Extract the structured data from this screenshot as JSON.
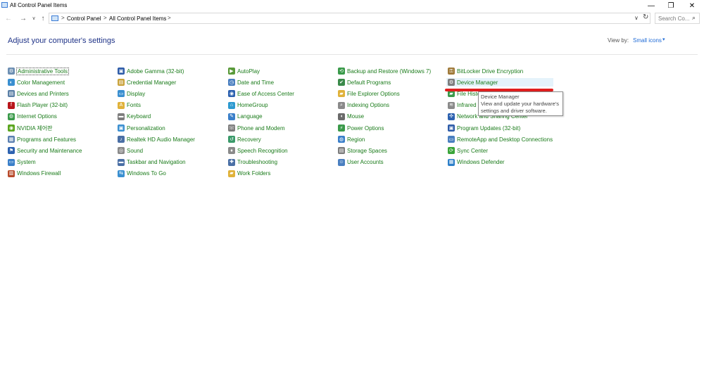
{
  "window": {
    "title": "All Control Panel Items",
    "minimize_glyph": "—",
    "maximize_glyph": "❐",
    "close_glyph": "✕"
  },
  "nav": {
    "back_glyph": "←",
    "forward_glyph": "→",
    "recent_glyph": "∨",
    "up_glyph": "↑",
    "breadcrumb": [
      "Control Panel",
      "All Control Panel Items"
    ],
    "crumb_separator": ">",
    "dropdown_glyph": "∨",
    "refresh_glyph": "↻",
    "search_placeholder": "Search Co...",
    "search_glyph": "⌕"
  },
  "header": {
    "title": "Adjust your computer's settings",
    "view_by_label": "View by:",
    "view_by_value": "Small icons",
    "view_by_caret": "▾"
  },
  "columns": [
    [
      {
        "label": "Administrative Tools",
        "icon": "administrative-tools-icon",
        "color": "#6d8fb3",
        "glyph": "⚙"
      },
      {
        "label": "Color Management",
        "icon": "color-management-icon",
        "color": "#3a8fd0",
        "glyph": "◐"
      },
      {
        "label": "Devices and Printers",
        "icon": "devices-printers-icon",
        "color": "#5b7fa6",
        "glyph": "▤"
      },
      {
        "label": "Flash Player (32-bit)",
        "icon": "flash-player-icon",
        "color": "#b8161b",
        "glyph": "f"
      },
      {
        "label": "Internet Options",
        "icon": "internet-options-icon",
        "color": "#3a9a4a",
        "glyph": "◍"
      },
      {
        "label": "NVIDIA 제어판",
        "icon": "nvidia-icon",
        "color": "#5aa51e",
        "glyph": "◉"
      },
      {
        "label": "Programs and Features",
        "icon": "programs-features-icon",
        "color": "#5a7fb0",
        "glyph": "▦"
      },
      {
        "label": "Security and Maintenance",
        "icon": "security-maintenance-icon",
        "color": "#2d62b0",
        "glyph": "⚑"
      },
      {
        "label": "System",
        "icon": "system-icon",
        "color": "#3a7fc9",
        "glyph": "▭"
      },
      {
        "label": "Windows Firewall",
        "icon": "windows-firewall-icon",
        "color": "#b84a2a",
        "glyph": "▥"
      }
    ],
    [
      {
        "label": "Adobe Gamma (32-bit)",
        "icon": "adobe-gamma-icon",
        "color": "#2d5ba8",
        "glyph": "▣"
      },
      {
        "label": "Credential Manager",
        "icon": "credential-manager-icon",
        "color": "#c9a23a",
        "glyph": "▤"
      },
      {
        "label": "Display",
        "icon": "display-icon",
        "color": "#3a8fd0",
        "glyph": "▭"
      },
      {
        "label": "Fonts",
        "icon": "fonts-icon",
        "color": "#e0b23a",
        "glyph": "A"
      },
      {
        "label": "Keyboard",
        "icon": "keyboard-icon",
        "color": "#7d7d7d",
        "glyph": "▬"
      },
      {
        "label": "Personalization",
        "icon": "personalization-icon",
        "color": "#3a8fd0",
        "glyph": "▣"
      },
      {
        "label": "Realtek HD Audio Manager",
        "icon": "realtek-audio-icon",
        "color": "#4a6fa5",
        "glyph": "♪"
      },
      {
        "label": "Sound",
        "icon": "sound-icon",
        "color": "#8a8a8a",
        "glyph": "◎"
      },
      {
        "label": "Taskbar and Navigation",
        "icon": "taskbar-navigation-icon",
        "color": "#4a6fa5",
        "glyph": "▬"
      },
      {
        "label": "Windows To Go",
        "icon": "windows-to-go-icon",
        "color": "#3a8fd0",
        "glyph": "⇆"
      }
    ],
    [
      {
        "label": "AutoPlay",
        "icon": "autoplay-icon",
        "color": "#5a9a3a",
        "glyph": "▶"
      },
      {
        "label": "Date and Time",
        "icon": "date-time-icon",
        "color": "#4a7fc0",
        "glyph": "◷"
      },
      {
        "label": "Ease of Access Center",
        "icon": "ease-of-access-icon",
        "color": "#2d62b0",
        "glyph": "◉"
      },
      {
        "label": "HomeGroup",
        "icon": "homegroup-icon",
        "color": "#2d9ad0",
        "glyph": "⌂"
      },
      {
        "label": "Language",
        "icon": "language-icon",
        "color": "#3a7fc9",
        "glyph": "✎"
      },
      {
        "label": "Phone and Modem",
        "icon": "phone-modem-icon",
        "color": "#7d7d7d",
        "glyph": "☏"
      },
      {
        "label": "Recovery",
        "icon": "recovery-icon",
        "color": "#3a9a6a",
        "glyph": "↺"
      },
      {
        "label": "Speech Recognition",
        "icon": "speech-recognition-icon",
        "color": "#8a8a8a",
        "glyph": "♦"
      },
      {
        "label": "Troubleshooting",
        "icon": "troubleshooting-icon",
        "color": "#4a6fa5",
        "glyph": "✚"
      },
      {
        "label": "Work Folders",
        "icon": "work-folders-icon",
        "color": "#e0b23a",
        "glyph": "▰"
      }
    ],
    [
      {
        "label": "Backup and Restore (Windows 7)",
        "icon": "backup-restore-icon",
        "color": "#3a9a4a",
        "glyph": "⟲"
      },
      {
        "label": "Default Programs",
        "icon": "default-programs-icon",
        "color": "#3a8a4a",
        "glyph": "✔"
      },
      {
        "label": "File Explorer Options",
        "icon": "file-explorer-options-icon",
        "color": "#e0b23a",
        "glyph": "▰"
      },
      {
        "label": "Indexing Options",
        "icon": "indexing-options-icon",
        "color": "#8a8a8a",
        "glyph": "⌕"
      },
      {
        "label": "Mouse",
        "icon": "mouse-icon",
        "color": "#6a6a6a",
        "glyph": "◖"
      },
      {
        "label": "Power Options",
        "icon": "power-options-icon",
        "color": "#3a9a4a",
        "glyph": "⚡"
      },
      {
        "label": "Region",
        "icon": "region-icon",
        "color": "#3a7fc9",
        "glyph": "◍"
      },
      {
        "label": "Storage Spaces",
        "icon": "storage-spaces-icon",
        "color": "#7d7d7d",
        "glyph": "▤"
      },
      {
        "label": "User Accounts",
        "icon": "user-accounts-icon",
        "color": "#4a7fc0",
        "glyph": "☺"
      }
    ],
    [
      {
        "label": "BitLocker Drive Encryption",
        "icon": "bitlocker-icon",
        "color": "#a07a3a",
        "glyph": "⚿"
      },
      {
        "label": "Device Manager",
        "icon": "device-manager-icon",
        "color": "#7d7d7d",
        "glyph": "⚙"
      },
      {
        "label": "File History",
        "icon": "file-history-icon",
        "color": "#3a9a4a",
        "glyph": "▰"
      },
      {
        "label": "Infrared",
        "icon": "infrared-icon",
        "color": "#8a8a8a",
        "glyph": "≋"
      },
      {
        "label": "Network and Sharing Center",
        "icon": "network-sharing-icon",
        "color": "#2d62b0",
        "glyph": "✣"
      },
      {
        "label": "Program Updates (32-bit)",
        "icon": "program-updates-icon",
        "color": "#2d5ba8",
        "glyph": "▣"
      },
      {
        "label": "RemoteApp and Desktop Connections",
        "icon": "remoteapp-icon",
        "color": "#4a7fc0",
        "glyph": "▭"
      },
      {
        "label": "Sync Center",
        "icon": "sync-center-icon",
        "color": "#3aa53a",
        "glyph": "⟳"
      },
      {
        "label": "Windows Defender",
        "icon": "windows-defender-icon",
        "color": "#2d7fc9",
        "glyph": "▦"
      }
    ]
  ],
  "tooltip": {
    "title": "Device Manager",
    "description": "View and update your hardware's settings and driver software."
  }
}
